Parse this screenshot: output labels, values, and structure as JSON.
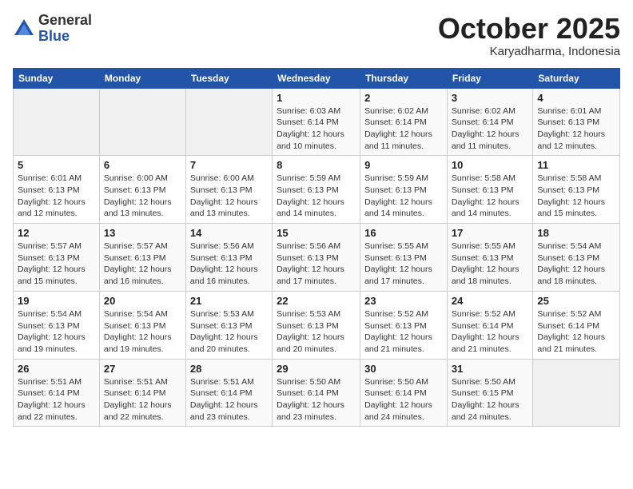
{
  "header": {
    "logo_general": "General",
    "logo_blue": "Blue",
    "month": "October 2025",
    "location": "Karyadharma, Indonesia"
  },
  "weekdays": [
    "Sunday",
    "Monday",
    "Tuesday",
    "Wednesday",
    "Thursday",
    "Friday",
    "Saturday"
  ],
  "weeks": [
    [
      {
        "day": "",
        "detail": ""
      },
      {
        "day": "",
        "detail": ""
      },
      {
        "day": "",
        "detail": ""
      },
      {
        "day": "1",
        "detail": "Sunrise: 6:03 AM\nSunset: 6:14 PM\nDaylight: 12 hours\nand 10 minutes."
      },
      {
        "day": "2",
        "detail": "Sunrise: 6:02 AM\nSunset: 6:14 PM\nDaylight: 12 hours\nand 11 minutes."
      },
      {
        "day": "3",
        "detail": "Sunrise: 6:02 AM\nSunset: 6:14 PM\nDaylight: 12 hours\nand 11 minutes."
      },
      {
        "day": "4",
        "detail": "Sunrise: 6:01 AM\nSunset: 6:13 PM\nDaylight: 12 hours\nand 12 minutes."
      }
    ],
    [
      {
        "day": "5",
        "detail": "Sunrise: 6:01 AM\nSunset: 6:13 PM\nDaylight: 12 hours\nand 12 minutes."
      },
      {
        "day": "6",
        "detail": "Sunrise: 6:00 AM\nSunset: 6:13 PM\nDaylight: 12 hours\nand 13 minutes."
      },
      {
        "day": "7",
        "detail": "Sunrise: 6:00 AM\nSunset: 6:13 PM\nDaylight: 12 hours\nand 13 minutes."
      },
      {
        "day": "8",
        "detail": "Sunrise: 5:59 AM\nSunset: 6:13 PM\nDaylight: 12 hours\nand 14 minutes."
      },
      {
        "day": "9",
        "detail": "Sunrise: 5:59 AM\nSunset: 6:13 PM\nDaylight: 12 hours\nand 14 minutes."
      },
      {
        "day": "10",
        "detail": "Sunrise: 5:58 AM\nSunset: 6:13 PM\nDaylight: 12 hours\nand 14 minutes."
      },
      {
        "day": "11",
        "detail": "Sunrise: 5:58 AM\nSunset: 6:13 PM\nDaylight: 12 hours\nand 15 minutes."
      }
    ],
    [
      {
        "day": "12",
        "detail": "Sunrise: 5:57 AM\nSunset: 6:13 PM\nDaylight: 12 hours\nand 15 minutes."
      },
      {
        "day": "13",
        "detail": "Sunrise: 5:57 AM\nSunset: 6:13 PM\nDaylight: 12 hours\nand 16 minutes."
      },
      {
        "day": "14",
        "detail": "Sunrise: 5:56 AM\nSunset: 6:13 PM\nDaylight: 12 hours\nand 16 minutes."
      },
      {
        "day": "15",
        "detail": "Sunrise: 5:56 AM\nSunset: 6:13 PM\nDaylight: 12 hours\nand 17 minutes."
      },
      {
        "day": "16",
        "detail": "Sunrise: 5:55 AM\nSunset: 6:13 PM\nDaylight: 12 hours\nand 17 minutes."
      },
      {
        "day": "17",
        "detail": "Sunrise: 5:55 AM\nSunset: 6:13 PM\nDaylight: 12 hours\nand 18 minutes."
      },
      {
        "day": "18",
        "detail": "Sunrise: 5:54 AM\nSunset: 6:13 PM\nDaylight: 12 hours\nand 18 minutes."
      }
    ],
    [
      {
        "day": "19",
        "detail": "Sunrise: 5:54 AM\nSunset: 6:13 PM\nDaylight: 12 hours\nand 19 minutes."
      },
      {
        "day": "20",
        "detail": "Sunrise: 5:54 AM\nSunset: 6:13 PM\nDaylight: 12 hours\nand 19 minutes."
      },
      {
        "day": "21",
        "detail": "Sunrise: 5:53 AM\nSunset: 6:13 PM\nDaylight: 12 hours\nand 20 minutes."
      },
      {
        "day": "22",
        "detail": "Sunrise: 5:53 AM\nSunset: 6:13 PM\nDaylight: 12 hours\nand 20 minutes."
      },
      {
        "day": "23",
        "detail": "Sunrise: 5:52 AM\nSunset: 6:13 PM\nDaylight: 12 hours\nand 21 minutes."
      },
      {
        "day": "24",
        "detail": "Sunrise: 5:52 AM\nSunset: 6:14 PM\nDaylight: 12 hours\nand 21 minutes."
      },
      {
        "day": "25",
        "detail": "Sunrise: 5:52 AM\nSunset: 6:14 PM\nDaylight: 12 hours\nand 21 minutes."
      }
    ],
    [
      {
        "day": "26",
        "detail": "Sunrise: 5:51 AM\nSunset: 6:14 PM\nDaylight: 12 hours\nand 22 minutes."
      },
      {
        "day": "27",
        "detail": "Sunrise: 5:51 AM\nSunset: 6:14 PM\nDaylight: 12 hours\nand 22 minutes."
      },
      {
        "day": "28",
        "detail": "Sunrise: 5:51 AM\nSunset: 6:14 PM\nDaylight: 12 hours\nand 23 minutes."
      },
      {
        "day": "29",
        "detail": "Sunrise: 5:50 AM\nSunset: 6:14 PM\nDaylight: 12 hours\nand 23 minutes."
      },
      {
        "day": "30",
        "detail": "Sunrise: 5:50 AM\nSunset: 6:14 PM\nDaylight: 12 hours\nand 24 minutes."
      },
      {
        "day": "31",
        "detail": "Sunrise: 5:50 AM\nSunset: 6:15 PM\nDaylight: 12 hours\nand 24 minutes."
      },
      {
        "day": "",
        "detail": ""
      }
    ]
  ]
}
